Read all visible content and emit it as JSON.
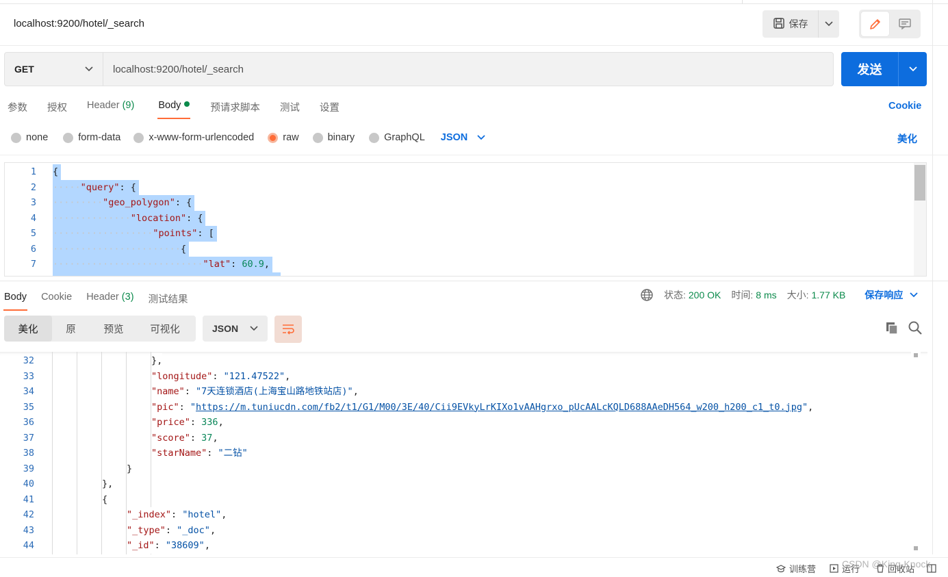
{
  "header": {
    "request_title": "localhost:9200/hotel/_search",
    "save_label": "保存"
  },
  "url_bar": {
    "method": "GET",
    "url": "localhost:9200/hotel/_search",
    "send_label": "发送"
  },
  "request_tabs": [
    {
      "label": "参数"
    },
    {
      "label": "授权"
    },
    {
      "label": "Header",
      "count": "(9)"
    },
    {
      "label": "Body"
    },
    {
      "label": "预请求脚本"
    },
    {
      "label": "测试"
    },
    {
      "label": "设置"
    }
  ],
  "cookie_link": "Cookie",
  "body_types": [
    {
      "label": "none",
      "selected": false
    },
    {
      "label": "form-data",
      "selected": false
    },
    {
      "label": "x-www-form-urlencoded",
      "selected": false
    },
    {
      "label": "raw",
      "selected": true
    },
    {
      "label": "binary",
      "selected": false
    },
    {
      "label": "GraphQL",
      "selected": false
    }
  ],
  "body_language": "JSON",
  "beautify_label": "美化",
  "request_body": [
    {
      "n": "1",
      "indent": 0,
      "tokens": [
        [
          "pun",
          "{"
        ]
      ]
    },
    {
      "n": "2",
      "indent": 1,
      "tokens": [
        [
          "key",
          "\"query\""
        ],
        [
          "pun",
          ": {"
        ]
      ]
    },
    {
      "n": "3",
      "indent": 2,
      "tokens": [
        [
          "key",
          "\"geo_polygon\""
        ],
        [
          "pun",
          ": {"
        ]
      ]
    },
    {
      "n": "4",
      "indent": 3,
      "tokens": [
        [
          "key",
          "\"location\""
        ],
        [
          "pun",
          ": {"
        ]
      ]
    },
    {
      "n": "5",
      "indent": 4,
      "tokens": [
        [
          "key",
          "\"points\""
        ],
        [
          "pun",
          ": ["
        ]
      ]
    },
    {
      "n": "6",
      "indent": 5,
      "tokens": [
        [
          "pun",
          "{"
        ]
      ]
    },
    {
      "n": "7",
      "indent": 6,
      "tokens": [
        [
          "key",
          "\"lat\""
        ],
        [
          "pun",
          ": "
        ],
        [
          "num",
          "60.9"
        ],
        [
          "pun",
          ","
        ]
      ]
    }
  ],
  "response_tabs": [
    {
      "label": "Body"
    },
    {
      "label": "Cookie"
    },
    {
      "label": "Header",
      "count": "(3)"
    },
    {
      "label": "测试结果"
    }
  ],
  "response_meta": {
    "status_label": "状态:",
    "status_value": "200 OK",
    "time_label": "时间:",
    "time_value": "8 ms",
    "size_label": "大小:",
    "size_value": "1.77 KB",
    "save_response": "保存响应"
  },
  "format_buttons": [
    {
      "label": "美化",
      "active": true
    },
    {
      "label": "原",
      "active": false
    },
    {
      "label": "预览",
      "active": false
    },
    {
      "label": "可视化",
      "active": false
    }
  ],
  "response_language": "JSON",
  "response_body": [
    {
      "n": "32",
      "col": 5,
      "tokens": [
        [
          "pun",
          "},"
        ]
      ]
    },
    {
      "n": "33",
      "col": 5,
      "tokens": [
        [
          "key",
          "\"longitude\""
        ],
        [
          "pun",
          ": "
        ],
        [
          "str",
          "\"121.47522\""
        ],
        [
          "pun",
          ","
        ]
      ]
    },
    {
      "n": "34",
      "col": 5,
      "tokens": [
        [
          "key",
          "\"name\""
        ],
        [
          "pun",
          ": "
        ],
        [
          "str",
          "\"7天连锁酒店(上海宝山路地铁站店)\""
        ],
        [
          "pun",
          ","
        ]
      ]
    },
    {
      "n": "35",
      "col": 5,
      "tokens": [
        [
          "key",
          "\"pic\""
        ],
        [
          "pun",
          ": "
        ],
        [
          "str",
          "\""
        ],
        [
          "link",
          "https://m.tuniucdn.com/fb2/t1/G1/M00/3E/40/Cii9EVkyLrKIXo1vAAHgrxo_pUcAALcKQLD688AAeDH564_w200_h200_c1_t0.jpg"
        ],
        [
          "str",
          "\""
        ],
        [
          "pun",
          ","
        ]
      ]
    },
    {
      "n": "36",
      "col": 5,
      "tokens": [
        [
          "key",
          "\"price\""
        ],
        [
          "pun",
          ": "
        ],
        [
          "num",
          "336"
        ],
        [
          "pun",
          ","
        ]
      ]
    },
    {
      "n": "37",
      "col": 5,
      "tokens": [
        [
          "key",
          "\"score\""
        ],
        [
          "pun",
          ": "
        ],
        [
          "num",
          "37"
        ],
        [
          "pun",
          ","
        ]
      ]
    },
    {
      "n": "38",
      "col": 5,
      "tokens": [
        [
          "key",
          "\"starName\""
        ],
        [
          "pun",
          ": "
        ],
        [
          "str",
          "\"二钻\""
        ]
      ]
    },
    {
      "n": "39",
      "col": 4,
      "tokens": [
        [
          "pun",
          "}"
        ]
      ]
    },
    {
      "n": "40",
      "col": 3,
      "tokens": [
        [
          "pun",
          "},"
        ]
      ]
    },
    {
      "n": "41",
      "col": 3,
      "tokens": [
        [
          "pun",
          "{"
        ]
      ]
    },
    {
      "n": "42",
      "col": 4,
      "tokens": [
        [
          "key",
          "\"_index\""
        ],
        [
          "pun",
          ": "
        ],
        [
          "str",
          "\"hotel\""
        ],
        [
          "pun",
          ","
        ]
      ]
    },
    {
      "n": "43",
      "col": 4,
      "tokens": [
        [
          "key",
          "\"_type\""
        ],
        [
          "pun",
          ": "
        ],
        [
          "str",
          "\"_doc\""
        ],
        [
          "pun",
          ","
        ]
      ]
    },
    {
      "n": "44",
      "col": 4,
      "tokens": [
        [
          "key",
          "\"_id\""
        ],
        [
          "pun",
          ": "
        ],
        [
          "str",
          "\"38609\""
        ],
        [
          "pun",
          ","
        ]
      ]
    }
  ],
  "status_bar": {
    "bootcamp": "训练营",
    "runner": "运行",
    "trash": "回收站"
  },
  "watermark": "CSDN @King-Knock",
  "colors": {
    "accent": "#ff6c37",
    "primary": "#0d6dde",
    "success": "#0b8a4b"
  }
}
